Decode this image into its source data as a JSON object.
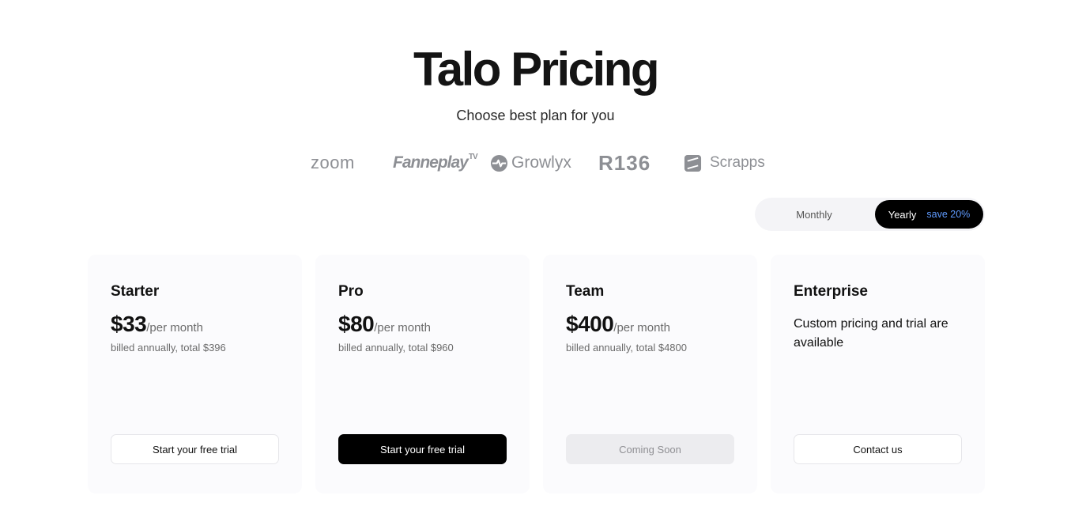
{
  "header": {
    "title": "Talo Pricing",
    "subtitle": "Choose best plan for you"
  },
  "logos": {
    "zoom": "zoom",
    "fanneplay": "Fanneplay",
    "fanneplay_sup": "TV",
    "growlyx": "Growlyx",
    "r136": "R136",
    "scrapps": "Scrapps"
  },
  "billing_toggle": {
    "monthly_label": "Monthly",
    "yearly_label": "Yearly",
    "yearly_badge": "save 20%",
    "selected": "Yearly"
  },
  "colors": {
    "accent": "#5f9bff",
    "primary": "#000000",
    "card_bg": "#fbfbfd"
  },
  "plans": [
    {
      "name": "Starter",
      "price": "$33",
      "period": "/per month",
      "billing_note": "billed annually, total $396",
      "cta_label": "Start your free trial"
    },
    {
      "name": "Pro",
      "price": "$80",
      "period": "/per month",
      "billing_note": "billed annually, total $960",
      "cta_label": "Start your free trial"
    },
    {
      "name": "Team",
      "price": "$400",
      "period": "/per month",
      "billing_note": "billed annually, total $4800",
      "cta_label": "Coming Soon"
    },
    {
      "name": "Enterprise",
      "description": "Custom pricing and trial are available",
      "cta_label": "Contact us"
    }
  ]
}
